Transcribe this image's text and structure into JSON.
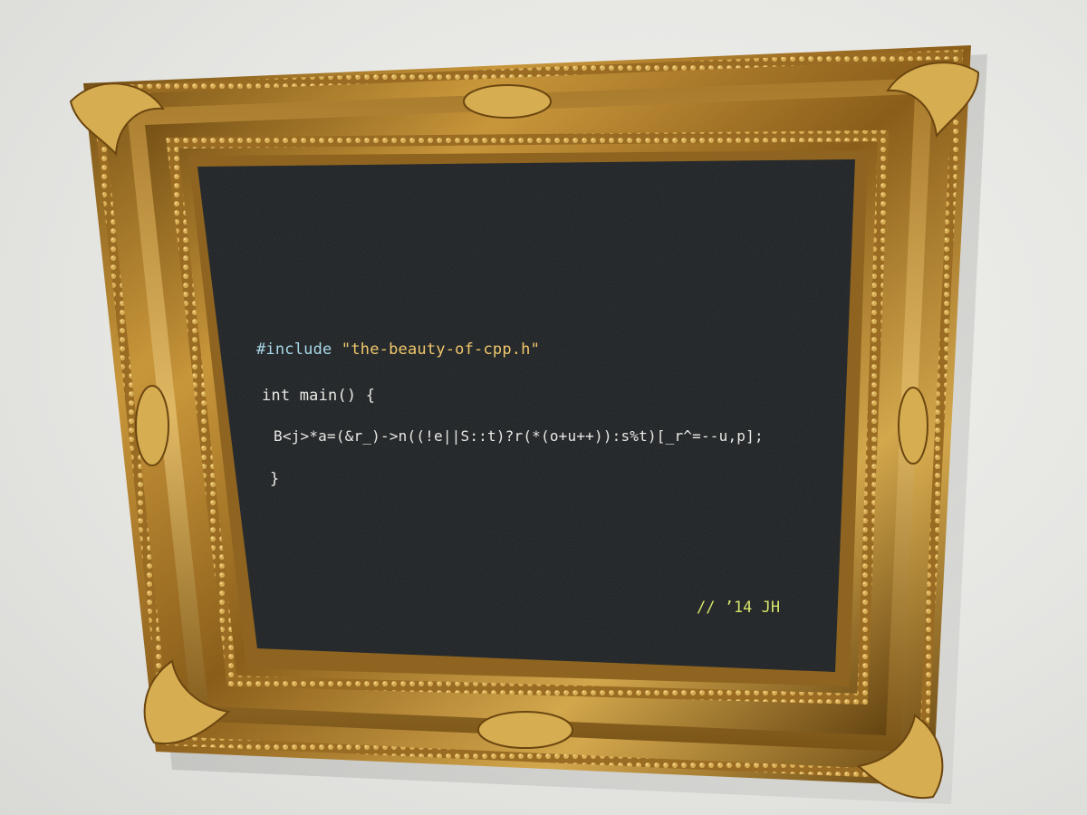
{
  "photo": {
    "wall_color": "#e6e6e3",
    "frame_color": "#b8862c",
    "canvas_color": "#1c1f21"
  },
  "code": {
    "include_directive": "#include",
    "include_file": "\"the-beauty-of-cpp.h\"",
    "main_signature": "int main() {",
    "body": "B<j>*a=(&r_)->n((!e||S::t)?r(*(o+u++)):s%t)[_r^=--u,p];",
    "closing_brace": "}"
  },
  "signature": "// ’14 JH"
}
